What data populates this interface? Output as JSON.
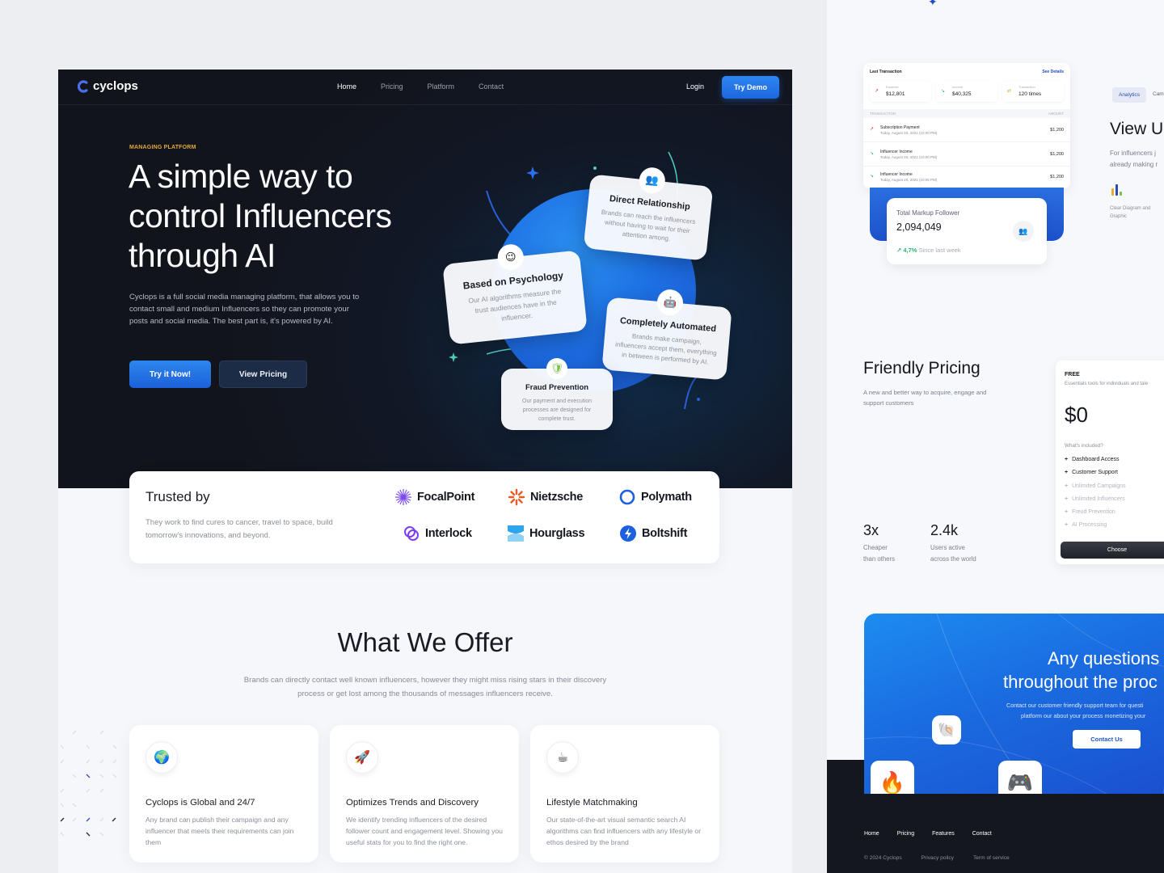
{
  "nav": {
    "logo": "cyclops",
    "links": [
      "Home",
      "Pricing",
      "Platform",
      "Contact"
    ],
    "active_link": "Home",
    "login": "Login",
    "try_demo": "Try Demo"
  },
  "hero": {
    "eyebrow": "MANAGING PLATFORM",
    "title_lines": [
      "A simple way to",
      "control Influencers",
      "through AI"
    ],
    "description": "Cyclops is a full social media managing platform, that allows you to contact small and medium Influencers so they can promote your posts and social media. The best part is, it's powered by AI.",
    "primary_button": "Try it Now!",
    "secondary_button": "View Pricing"
  },
  "feature_cards": [
    {
      "icon": "people-icon",
      "glyph": "👥",
      "title": "Direct Relationship",
      "text": "Brands can reach the influencers without having to wait for their attention among."
    },
    {
      "icon": "smile-icon",
      "glyph": "😉",
      "title": "Based on Psychology",
      "text": "Our AI algorithms measure the trust audiences have in the influencer."
    },
    {
      "icon": "robot-icon",
      "glyph": "🤖",
      "title": "Completely Automated",
      "text": "Brands make campaign, influencers accept them, everything in between is performed by AI."
    },
    {
      "icon": "shield-icon",
      "glyph": "🛡",
      "title": "Fraud Prevention",
      "text": "Our payment and execution processes are designed for complete trust."
    }
  ],
  "trusted": {
    "title": "Trusted by",
    "description": "They work to find cures to cancer, travel to space, build tomorrow's innovations, and beyond.",
    "brands": [
      "FocalPoint",
      "Nietzsche",
      "Polymath",
      "Interlock",
      "Hourglass",
      "Boltshift"
    ]
  },
  "offer": {
    "title": "What We Offer",
    "description": "Brands can directly contact well known influencers, however they might miss rising stars in their discovery process or get lost among the thousands of messages influencers receive.",
    "cards": [
      {
        "icon": "globe-icon",
        "glyph": "🌍",
        "title": "Cyclops is Global and 24/7",
        "text": "Any brand can publish their campaign and any influencer that meets their requirements can join them"
      },
      {
        "icon": "rocket-icon",
        "glyph": "🚀",
        "title": "Optimizes Trends and Discovery",
        "text": "We identify trending influencers of the desired follower count and engagement level. Showing you useful stats for you to find the right one."
      },
      {
        "icon": "lifestyle-icon",
        "glyph": "☕",
        "title": "Lifestyle Matchmaking",
        "text": "Our state-of-the-art visual semantic search AI algorithms can find influencers with any lifestyle or ethos desired by the brand"
      }
    ]
  },
  "transactions": {
    "title": "Last Transaction",
    "see_details": "See Details",
    "stats": [
      {
        "label": "Expense",
        "value": "$12,801",
        "icon": "↗",
        "color": "#d6334a"
      },
      {
        "label": "Income",
        "value": "$40,325",
        "icon": "↘",
        "color": "#2bb673"
      },
      {
        "label": "Transaction",
        "value": "120 times",
        "icon": "⇄",
        "color": "#e4a93b"
      }
    ],
    "columns": [
      "TRANSACTION",
      "AMOUNT"
    ],
    "rows": [
      {
        "name": "Subscription Payment",
        "date": "Today, August 20, 2021 (10:00 PM)",
        "amount": "$1,200",
        "dir": "↗",
        "color": "#d6334a"
      },
      {
        "name": "Influencer Income",
        "date": "Today, August 20, 2021 (10:00 PM)",
        "amount": "$1,200",
        "dir": "↘",
        "color": "#2bb673"
      },
      {
        "name": "Influencer Income",
        "date": "Today, August 20, 2021 (10:05 PM)",
        "amount": "$1,200",
        "dir": "↘",
        "color": "#2bb673"
      }
    ]
  },
  "follower": {
    "label": "Total Markup Follower",
    "value": "2,094,049",
    "growth": "4,7%",
    "growth_label": "Since last week"
  },
  "view": {
    "tabs": [
      "Analytics",
      "Cam"
    ],
    "title": "View U",
    "description_lines": [
      "For influencers j",
      "already making r"
    ],
    "feature_caption": [
      "Clear Diagram and",
      "Graphic"
    ]
  },
  "pricing": {
    "title": "Friendly Pricing",
    "description": "A new and better way to acquire, engage and support customers",
    "stats": [
      {
        "value": "3x",
        "label_lines": [
          "Cheaper",
          "than others"
        ]
      },
      {
        "value": "2.4k",
        "label_lines": [
          "Users active",
          "across the world"
        ]
      }
    ],
    "plan": {
      "name": "FREE",
      "subtitle": "Essentials tools for individuals and tale",
      "price": "$0",
      "included_label": "What's included?",
      "features": [
        {
          "label": "Dashboard Access",
          "included": true
        },
        {
          "label": "Customer Support",
          "included": true
        },
        {
          "label": "Unlimited Campaigns",
          "included": false
        },
        {
          "label": "Unlimited Influencers",
          "included": false
        },
        {
          "label": "Freud Prevention",
          "included": false
        },
        {
          "label": "AI Processing",
          "included": false
        }
      ],
      "button": "Choose"
    }
  },
  "cta": {
    "title_lines": [
      "Any questions",
      "throughout the proc"
    ],
    "description_lines": [
      "Contact our customer friendly support team for questi",
      "platform our about your process monetizing your"
    ],
    "button": "Contact Us"
  },
  "footer": {
    "links": [
      "Home",
      "Pricing",
      "Features",
      "Contact"
    ],
    "copyright": "© 2024 Cyclops",
    "legal": [
      "Privacy policy",
      "Term of service"
    ]
  },
  "colors": {
    "accent": "#1f6fe5",
    "dark": "#12141b",
    "eyebrow": "#e4a93b",
    "success": "#2bb673",
    "danger": "#d6334a"
  }
}
